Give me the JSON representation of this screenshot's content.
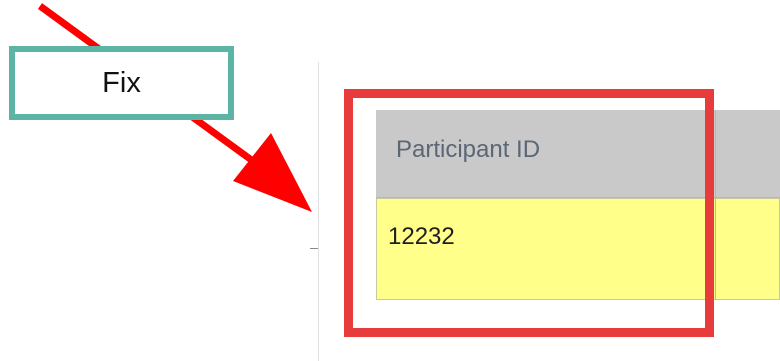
{
  "callout": {
    "label": "Fix"
  },
  "grid": {
    "columns": [
      {
        "header": "Participant ID"
      }
    ],
    "rows": [
      {
        "participant_id": "12232"
      }
    ]
  },
  "annotation": {
    "arrow_color": "#ff0000",
    "highlight_color": "#e83c3c",
    "callout_border_color": "#5cb5a4",
    "row_highlight_color": "#ffff8a"
  }
}
